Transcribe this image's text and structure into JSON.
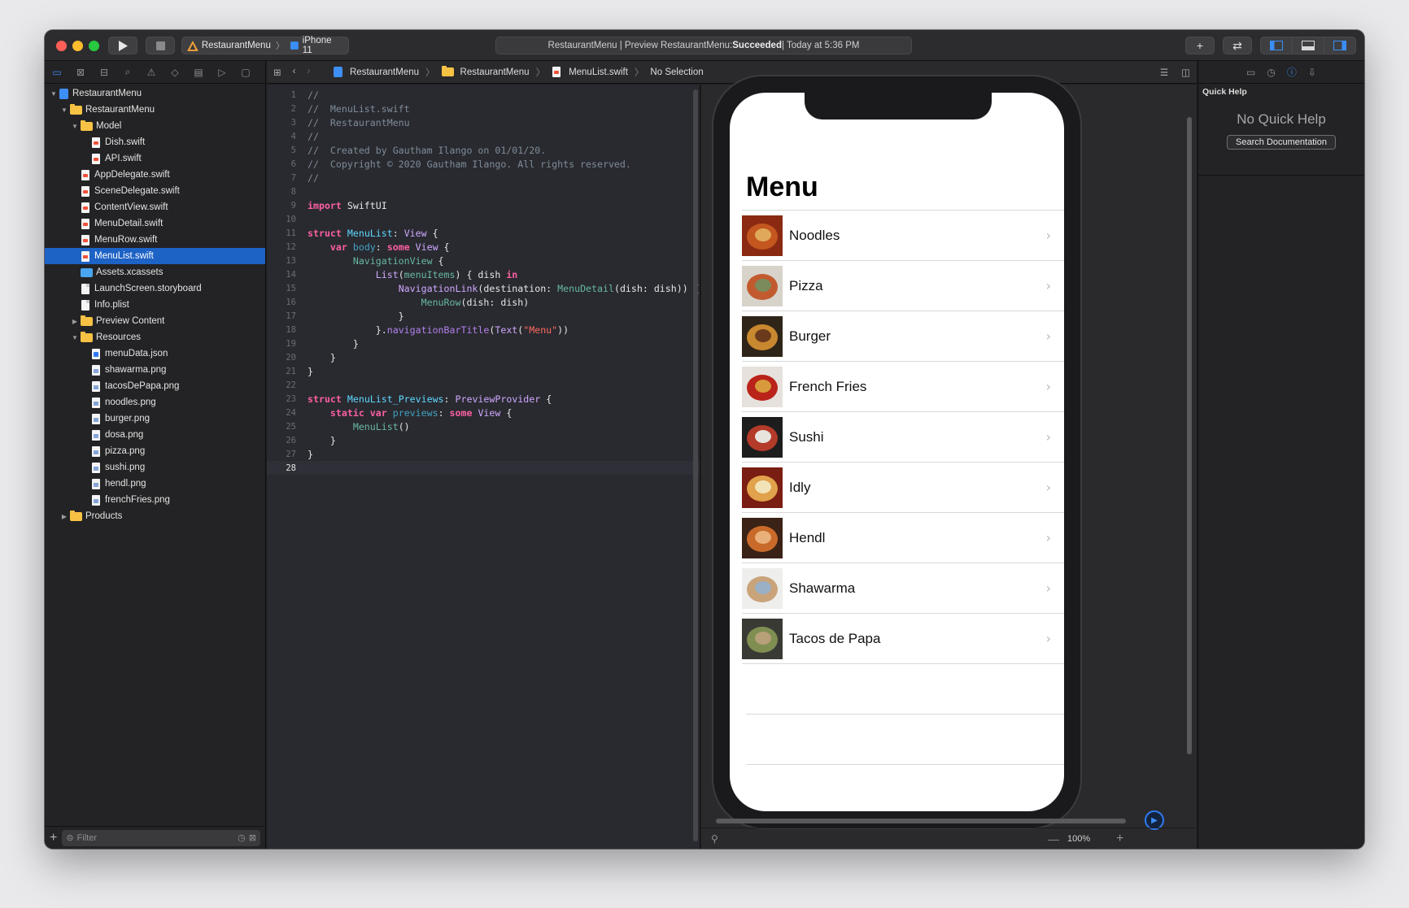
{
  "toolbar": {
    "scheme": "RestaurantMenu",
    "device": "iPhone 11",
    "activity_prefix": "RestaurantMenu | Preview RestaurantMenu: ",
    "activity_status": "Succeeded",
    "activity_suffix": " | Today at 5:36 PM"
  },
  "navigator": {
    "tabs": [
      "folder-icon",
      "source-control-icon",
      "symbol-icon",
      "search-icon",
      "warning-icon",
      "test-icon",
      "debug-icon",
      "breakpoint-icon",
      "report-icon"
    ],
    "tree": [
      {
        "label": "RestaurantMenu",
        "kind": "project",
        "depth": 0,
        "disclosure": "open"
      },
      {
        "label": "RestaurantMenu",
        "kind": "folder",
        "depth": 1,
        "disclosure": "open"
      },
      {
        "label": "Model",
        "kind": "folder",
        "depth": 2,
        "disclosure": "open"
      },
      {
        "label": "Dish.swift",
        "kind": "swift",
        "depth": 3
      },
      {
        "label": "API.swift",
        "kind": "swift",
        "depth": 3
      },
      {
        "label": "AppDelegate.swift",
        "kind": "swift",
        "depth": 2
      },
      {
        "label": "SceneDelegate.swift",
        "kind": "swift",
        "depth": 2
      },
      {
        "label": "ContentView.swift",
        "kind": "swift",
        "depth": 2
      },
      {
        "label": "MenuDetail.swift",
        "kind": "swift",
        "depth": 2
      },
      {
        "label": "MenuRow.swift",
        "kind": "swift",
        "depth": 2
      },
      {
        "label": "MenuList.swift",
        "kind": "swift",
        "depth": 2,
        "selected": true
      },
      {
        "label": "Assets.xcassets",
        "kind": "assets",
        "depth": 2
      },
      {
        "label": "LaunchScreen.storyboard",
        "kind": "file",
        "depth": 2
      },
      {
        "label": "Info.plist",
        "kind": "file",
        "depth": 2
      },
      {
        "label": "Preview Content",
        "kind": "folder",
        "depth": 2,
        "disclosure": "closed"
      },
      {
        "label": "Resources",
        "kind": "folder",
        "depth": 2,
        "disclosure": "open"
      },
      {
        "label": "menuData.json",
        "kind": "json",
        "depth": 3
      },
      {
        "label": "shawarma.png",
        "kind": "png",
        "depth": 3
      },
      {
        "label": "tacosDePapa.png",
        "kind": "png",
        "depth": 3
      },
      {
        "label": "noodles.png",
        "kind": "png",
        "depth": 3
      },
      {
        "label": "burger.png",
        "kind": "png",
        "depth": 3
      },
      {
        "label": "dosa.png",
        "kind": "png",
        "depth": 3
      },
      {
        "label": "pizza.png",
        "kind": "png",
        "depth": 3
      },
      {
        "label": "sushi.png",
        "kind": "png",
        "depth": 3
      },
      {
        "label": "hendl.png",
        "kind": "png",
        "depth": 3
      },
      {
        "label": "frenchFries.png",
        "kind": "png",
        "depth": 3
      },
      {
        "label": "Products",
        "kind": "folder",
        "depth": 1,
        "disclosure": "closed"
      }
    ],
    "filter_placeholder": "Filter"
  },
  "jumpbar": {
    "crumbs": [
      "RestaurantMenu",
      "RestaurantMenu",
      "MenuList.swift",
      "No Selection"
    ]
  },
  "editor": {
    "current_line": 28,
    "lines": [
      [
        [
          "c-com",
          "//"
        ]
      ],
      [
        [
          "c-com",
          "//  MenuList.swift"
        ]
      ],
      [
        [
          "c-com",
          "//  RestaurantMenu"
        ]
      ],
      [
        [
          "c-com",
          "//"
        ]
      ],
      [
        [
          "c-com",
          "//  Created by Gautham Ilango on 01/01/20."
        ]
      ],
      [
        [
          "c-com",
          "//  Copyright © 2020 Gautham Ilango. All rights reserved."
        ]
      ],
      [
        [
          "c-com",
          "//"
        ]
      ],
      [],
      [
        [
          "c-kw",
          "import"
        ],
        [
          "c-txt",
          " SwiftUI"
        ]
      ],
      [],
      [
        [
          "c-kw",
          "struct"
        ],
        [
          "c-txt",
          " "
        ],
        [
          "c-type",
          "MenuList"
        ],
        [
          "c-txt",
          ": "
        ],
        [
          "c-cls",
          "View"
        ],
        [
          "c-txt",
          " {"
        ]
      ],
      [
        [
          "c-txt",
          "    "
        ],
        [
          "c-kw",
          "var"
        ],
        [
          "c-txt",
          " "
        ],
        [
          "c-prop",
          "body"
        ],
        [
          "c-txt",
          ": "
        ],
        [
          "c-kw",
          "some"
        ],
        [
          "c-txt",
          " "
        ],
        [
          "c-cls",
          "View"
        ],
        [
          "c-txt",
          " {"
        ]
      ],
      [
        [
          "c-txt",
          "        "
        ],
        [
          "c-fn",
          "NavigationView"
        ],
        [
          "c-txt",
          " {"
        ]
      ],
      [
        [
          "c-txt",
          "            "
        ],
        [
          "c-cls",
          "List"
        ],
        [
          "c-txt",
          "("
        ],
        [
          "c-fn",
          "menuItems"
        ],
        [
          "c-txt",
          ") { dish "
        ],
        [
          "c-kw",
          "in"
        ]
      ],
      [
        [
          "c-txt",
          "                "
        ],
        [
          "c-cls",
          "NavigationLink"
        ],
        [
          "c-txt",
          "(destination: "
        ],
        [
          "c-fn",
          "MenuDetail"
        ],
        [
          "c-txt",
          "(dish: dish)) {"
        ]
      ],
      [
        [
          "c-txt",
          "                    "
        ],
        [
          "c-fn",
          "MenuRow"
        ],
        [
          "c-txt",
          "(dish: dish)"
        ]
      ],
      [
        [
          "c-txt",
          "                }"
        ]
      ],
      [
        [
          "c-txt",
          "            }."
        ],
        [
          "c-call",
          "navigationBarTitle"
        ],
        [
          "c-txt",
          "("
        ],
        [
          "c-cls",
          "Text"
        ],
        [
          "c-txt",
          "("
        ],
        [
          "c-str",
          "\"Menu\""
        ],
        [
          "c-txt",
          "))"
        ]
      ],
      [
        [
          "c-txt",
          "        }"
        ]
      ],
      [
        [
          "c-txt",
          "    }"
        ]
      ],
      [
        [
          "c-txt",
          "}"
        ]
      ],
      [],
      [
        [
          "c-kw",
          "struct"
        ],
        [
          "c-txt",
          " "
        ],
        [
          "c-type",
          "MenuList_Previews"
        ],
        [
          "c-txt",
          ": "
        ],
        [
          "c-cls",
          "PreviewProvider"
        ],
        [
          "c-txt",
          " {"
        ]
      ],
      [
        [
          "c-txt",
          "    "
        ],
        [
          "c-kw",
          "static"
        ],
        [
          "c-txt",
          " "
        ],
        [
          "c-kw",
          "var"
        ],
        [
          "c-txt",
          " "
        ],
        [
          "c-prop",
          "previews"
        ],
        [
          "c-txt",
          ": "
        ],
        [
          "c-kw",
          "some"
        ],
        [
          "c-txt",
          " "
        ],
        [
          "c-cls",
          "View"
        ],
        [
          "c-txt",
          " {"
        ]
      ],
      [
        [
          "c-txt",
          "        "
        ],
        [
          "c-fn",
          "MenuList"
        ],
        [
          "c-txt",
          "()"
        ]
      ],
      [
        [
          "c-txt",
          "    }"
        ]
      ],
      [
        [
          "c-txt",
          "}"
        ]
      ],
      []
    ]
  },
  "preview": {
    "title": "Menu",
    "items": [
      {
        "label": "Noodles",
        "colors": [
          "#8a2a12",
          "#c4571f",
          "#e0a85a"
        ]
      },
      {
        "label": "Pizza",
        "colors": [
          "#d8d3ca",
          "#c25a2f",
          "#7a8b5c"
        ]
      },
      {
        "label": "Burger",
        "colors": [
          "#2e2418",
          "#c8882f",
          "#6b3a1c"
        ]
      },
      {
        "label": "French Fries",
        "colors": [
          "#e6e1dc",
          "#b9231a",
          "#d89a3b"
        ]
      },
      {
        "label": "Sushi",
        "colors": [
          "#1d1d1d",
          "#b43a2a",
          "#e7e3dd"
        ]
      },
      {
        "label": "Idly",
        "colors": [
          "#7a1d12",
          "#e0a24a",
          "#f2e2b8"
        ]
      },
      {
        "label": "Hendl",
        "colors": [
          "#3a2216",
          "#c96a2a",
          "#e9b07a"
        ]
      },
      {
        "label": "Shawarma",
        "colors": [
          "#eeeeec",
          "#c9a37a",
          "#9ab0c4"
        ]
      },
      {
        "label": "Tacos de Papa",
        "colors": [
          "#3a3a34",
          "#7f8f52",
          "#b8a07a"
        ]
      }
    ],
    "empty_rows": 2,
    "zoom": "100%"
  },
  "inspector": {
    "title": "Quick Help",
    "empty_text": "No Quick Help",
    "button": "Search Documentation"
  },
  "colors": {
    "accent": "#3a8ef6",
    "selection": "#1d62c5",
    "status_succeeded": "#ececec"
  }
}
